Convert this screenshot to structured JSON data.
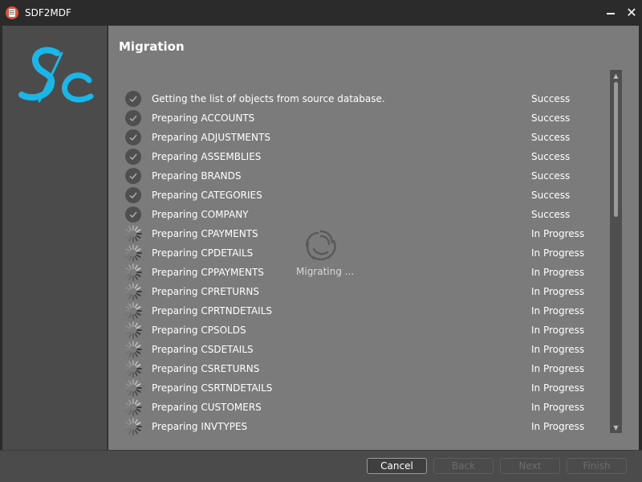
{
  "window": {
    "title": "SDF2MDF",
    "icon": "app-icon",
    "controls": {
      "minimize": "minimize-icon",
      "close_glyph": "✕"
    }
  },
  "sidebar": {
    "logo": "sc-logo",
    "logo_color": "#1ab6e8"
  },
  "main": {
    "title": "Migration",
    "busy_text": "Migrating ...",
    "items": [
      {
        "label": "Getting the list of objects from source database.",
        "status": "Success",
        "state": "done"
      },
      {
        "label": "Preparing ACCOUNTS",
        "status": "Success",
        "state": "done"
      },
      {
        "label": "Preparing ADJUSTMENTS",
        "status": "Success",
        "state": "done"
      },
      {
        "label": "Preparing ASSEMBLIES",
        "status": "Success",
        "state": "done"
      },
      {
        "label": "Preparing BRANDS",
        "status": "Success",
        "state": "done"
      },
      {
        "label": "Preparing CATEGORIES",
        "status": "Success",
        "state": "done"
      },
      {
        "label": "Preparing COMPANY",
        "status": "Success",
        "state": "done"
      },
      {
        "label": "Preparing CPAYMENTS",
        "status": "In Progress",
        "state": "progress"
      },
      {
        "label": "Preparing CPDETAILS",
        "status": "In Progress",
        "state": "progress"
      },
      {
        "label": "Preparing CPPAYMENTS",
        "status": "In Progress",
        "state": "progress"
      },
      {
        "label": "Preparing CPRETURNS",
        "status": "In Progress",
        "state": "progress"
      },
      {
        "label": "Preparing CPRTNDETAILS",
        "status": "In Progress",
        "state": "progress"
      },
      {
        "label": "Preparing CPSOLDS",
        "status": "In Progress",
        "state": "progress"
      },
      {
        "label": "Preparing CSDETAILS",
        "status": "In Progress",
        "state": "progress"
      },
      {
        "label": "Preparing CSRETURNS",
        "status": "In Progress",
        "state": "progress"
      },
      {
        "label": "Preparing CSRTNDETAILS",
        "status": "In Progress",
        "state": "progress"
      },
      {
        "label": "Preparing CUSTOMERS",
        "status": "In Progress",
        "state": "progress"
      },
      {
        "label": "Preparing INVTYPES",
        "status": "In Progress",
        "state": "progress"
      }
    ]
  },
  "footer": {
    "cancel_label": "Cancel",
    "back_label": "Back",
    "next_label": "Next",
    "finish_label": "Finish"
  },
  "colors": {
    "titlebar_bg": "#2b2b2b",
    "sidebar_bg": "#4b4b4b",
    "content_bg": "#7b7b7b",
    "check_circle": "#4f4f4f"
  }
}
